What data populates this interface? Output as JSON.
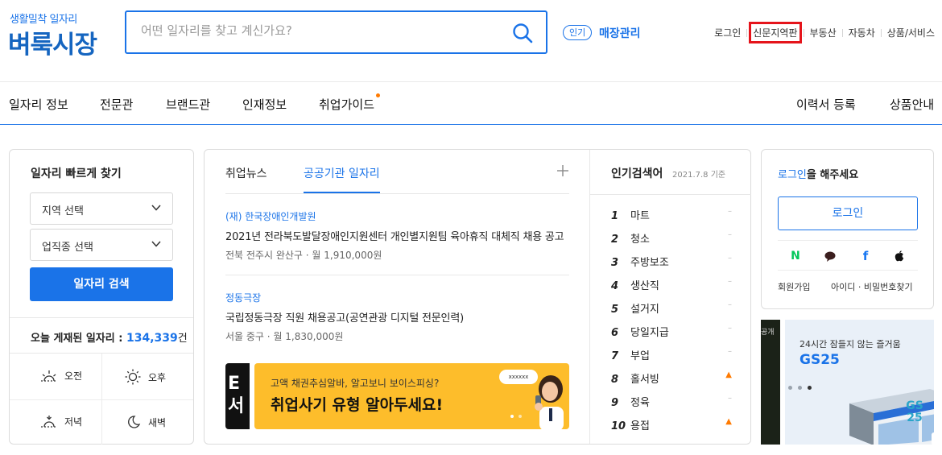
{
  "header": {
    "logo_sub": "생활밀착 일자리",
    "logo": "벼룩시장",
    "search_placeholder": "어떤 일자리를 찾고 계신가요?",
    "popular_badge": "인기",
    "store_link": "매장관리",
    "util_links": [
      "로그인",
      "신문지역판",
      "부동산",
      "자동차",
      "상품/서비스"
    ]
  },
  "nav": {
    "left": [
      "일자리 정보",
      "전문관",
      "브랜드관",
      "인재정보",
      "취업가이드"
    ],
    "right": [
      "이력서 등록",
      "상품안내"
    ]
  },
  "quick": {
    "title": "일자리 빠르게 찾기",
    "region_select": "지역 선택",
    "job_select": "업직종 선택",
    "search_button": "일자리 검색",
    "today_label": "오늘 게재된 일자리 : ",
    "today_count": "134,339",
    "today_unit": "건",
    "times": [
      "오전",
      "오후",
      "저녁",
      "새벽"
    ]
  },
  "news": {
    "tabs": [
      "취업뉴스",
      "공공기관 일자리"
    ],
    "active_tab": "공공기관 일자리",
    "jobs": [
      {
        "org": "(재) 한국장애인개발원",
        "title": "2021년 전라북도발달장애인지원센터 개인별지원팀 육아휴직 대체직 채용 공고",
        "location": "전북 전주시 완산구",
        "salary": "월 1,910,000원"
      },
      {
        "org": "정동극장",
        "title": "국립정동극장 직원 채용공고(공연관광 디지털 전문인력)",
        "location": "서울 중구",
        "salary": "월 1,830,000원"
      }
    ],
    "banner_left_text": "E\n서",
    "banner_sub": "고액 채권추심알바, 알고보니 보이스피싱?",
    "banner_title": "취업사기 유형 알아두세요!",
    "banner_bubble": "xxxxxx"
  },
  "popular": {
    "title": "인기검색어",
    "date": "2021.7.8 기준",
    "items": [
      {
        "rank": "1",
        "word": "마트",
        "trend": "–"
      },
      {
        "rank": "2",
        "word": "청소",
        "trend": "–"
      },
      {
        "rank": "3",
        "word": "주방보조",
        "trend": "–"
      },
      {
        "rank": "4",
        "word": "생산직",
        "trend": "–"
      },
      {
        "rank": "5",
        "word": "설거지",
        "trend": "–"
      },
      {
        "rank": "6",
        "word": "당일지급",
        "trend": "–"
      },
      {
        "rank": "7",
        "word": "부업",
        "trend": "–"
      },
      {
        "rank": "8",
        "word": "홀서빙",
        "trend": "▲"
      },
      {
        "rank": "9",
        "word": "정육",
        "trend": "–"
      },
      {
        "rank": "10",
        "word": "용접",
        "trend": "▲"
      }
    ]
  },
  "login": {
    "msg_link": "로그인",
    "msg_rest": "을 해주세요",
    "button": "로그인",
    "social": [
      "N",
      "●",
      "f",
      ""
    ],
    "signup": "회원가입",
    "find": "아이디 · 비밀번호찾기"
  },
  "ad": {
    "dark_text": "공개",
    "sub": "24시간 잠들지 않는 즐거움",
    "brand": "GS25",
    "sign": "GS 25"
  }
}
